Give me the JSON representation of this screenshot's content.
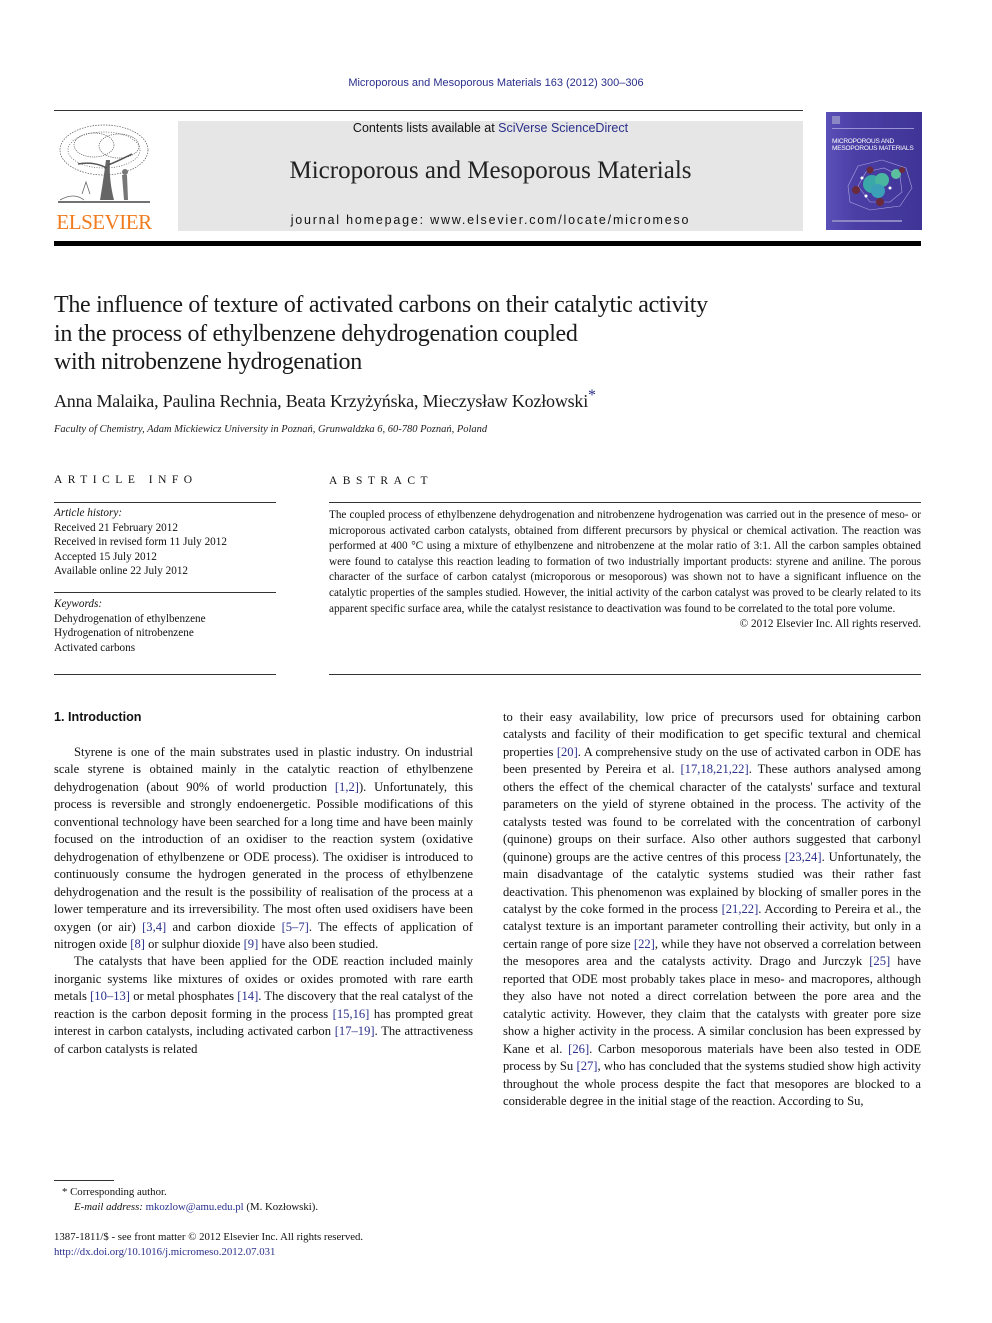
{
  "header": {
    "running_head": "Microporous and Mesoporous Materials 163 (2012) 300–306",
    "contents_prefix": "Contents lists available at ",
    "contents_link": "SciVerse ScienceDirect",
    "journal_title": "Microporous and Mesoporous Materials",
    "homepage": "journal homepage: www.elsevier.com/locate/micromeso",
    "publisher_logo_text": "ELSEVIER",
    "cover_title_line1": "MICROPOROUS AND",
    "cover_title_line2": "MESOPOROUS MATERIALS",
    "colors": {
      "link": "#2a2f8a",
      "elsevier_orange": "#f07c1f",
      "banner_bg": "#e6e6e6",
      "cover_bg": "#4b3fa6"
    }
  },
  "article": {
    "title_lines": [
      "The influence of texture of activated carbons on their catalytic activity",
      "in the process of ethylbenzene dehydrogenation coupled",
      "with nitrobenzene hydrogenation"
    ],
    "authors": "Anna Malaika, Paulina Rechnia, Beata Krzyżyńska, Mieczysław Kozłowski",
    "corresponding_mark": "*",
    "affiliation": "Faculty of Chemistry, Adam Mickiewicz University in Poznań, Grunwaldzka 6, 60-780 Poznań, Poland"
  },
  "article_info": {
    "heading": "ARTICLE INFO",
    "history_label": "Article history:",
    "history": [
      "Received 21 February 2012",
      "Received in revised form 11 July 2012",
      "Accepted 15 July 2012",
      "Available online 22 July 2012"
    ],
    "keywords_label": "Keywords:",
    "keywords": [
      "Dehydrogenation of ethylbenzene",
      "Hydrogenation of nitrobenzene",
      "Activated carbons"
    ]
  },
  "abstract": {
    "heading": "ABSTRACT",
    "text": "The coupled process of ethylbenzene dehydrogenation and nitrobenzene hydrogenation was carried out in the presence of meso- or microporous activated carbon catalysts, obtained from different precursors by physical or chemical activation. The reaction was performed at 400 °C using a mixture of ethylbenzene and nitrobenzene at the molar ratio of 3:1. All the carbon samples obtained were found to catalyse this reaction leading to formation of two industrially important products: styrene and aniline. The porous character of the surface of carbon catalyst (microporous or mesoporous) was shown not to have a significant influence on the catalytic properties of the samples studied. However, the initial activity of the carbon catalyst was proved to be clearly related to its apparent specific surface area, while the catalyst resistance to deactivation was found to be correlated to the total pore volume.",
    "copyright": "© 2012 Elsevier Inc. All rights reserved."
  },
  "intro": {
    "heading": "1. Introduction",
    "p1": [
      {
        "t": "Styrene is one of the main substrates used in plastic industry. On industrial scale styrene is obtained mainly in the catalytic reaction of ethylbenzene dehydrogenation (about 90% of world production "
      },
      {
        "t": "[1,2]",
        "ref": true
      },
      {
        "t": "). Unfortunately, this process is reversible and strongly endoenergetic. Possible modifications of this conventional technology have been searched for a long time and have been mainly focused on the introduction of an oxidiser to the reaction system (oxidative dehydrogenation of ethylbenzene or ODE process). The oxidiser is introduced to continuously consume the hydrogen generated in the process of ethylbenzene dehydrogenation and the result is the possibility of realisation of the process at a lower temperature and its irreversibility. The most often used oxidisers have been oxygen (or air) "
      },
      {
        "t": "[3,4]",
        "ref": true
      },
      {
        "t": " and carbon dioxide "
      },
      {
        "t": "[5–7]",
        "ref": true
      },
      {
        "t": ". The effects of application of nitrogen oxide "
      },
      {
        "t": "[8]",
        "ref": true
      },
      {
        "t": " or sulphur dioxide "
      },
      {
        "t": "[9]",
        "ref": true
      },
      {
        "t": " have also been studied."
      }
    ],
    "p2": [
      {
        "t": "The catalysts that have been applied for the ODE reaction included mainly inorganic systems like mixtures of oxides or oxides promoted with rare earth metals "
      },
      {
        "t": "[10–13]",
        "ref": true
      },
      {
        "t": " or metal phosphates "
      },
      {
        "t": "[14]",
        "ref": true
      },
      {
        "t": ". The discovery that the real catalyst of the reaction is the carbon deposit forming in the process "
      },
      {
        "t": "[15,16]",
        "ref": true
      },
      {
        "t": " has prompted great interest in carbon catalysts, including activated carbon "
      },
      {
        "t": "[17–19]",
        "ref": true
      },
      {
        "t": ". The attractiveness of carbon catalysts is related"
      }
    ],
    "p3": [
      {
        "t": "to their easy availability, low price of precursors used for obtaining carbon catalysts and facility of their modification to get specific textural and chemical properties "
      },
      {
        "t": "[20]",
        "ref": true
      },
      {
        "t": ". A comprehensive study on the use of activated carbon in ODE has been presented by Pereira et al. "
      },
      {
        "t": "[17,18,21,22]",
        "ref": true
      },
      {
        "t": ". These authors analysed among others the effect of the chemical character of the catalysts' surface and textural parameters on the yield of styrene obtained in the process. The activity of the catalysts tested was found to be correlated with the concentration of carbonyl (quinone) groups on their surface. Also other authors suggested that carbonyl (quinone) groups are the active centres of this process "
      },
      {
        "t": "[23,24]",
        "ref": true
      },
      {
        "t": ". Unfortunately, the main disadvantage of the catalytic systems studied was their rather fast deactivation. This phenomenon was explained by blocking of smaller pores in the catalyst by the coke formed in the process "
      },
      {
        "t": "[21,22]",
        "ref": true
      },
      {
        "t": ". According to Pereira et al., the catalyst texture is an important parameter controlling their activity, but only in a certain range of pore size "
      },
      {
        "t": "[22]",
        "ref": true
      },
      {
        "t": ", while they have not observed a correlation between the mesopores area and the catalysts activity. Drago and Jurczyk "
      },
      {
        "t": "[25]",
        "ref": true
      },
      {
        "t": " have reported that ODE most probably takes place in meso- and macropores, although they also have not noted a direct correlation between the pore area and the catalytic activity. However, they claim that the catalysts with greater pore size show a higher activity in the process. A similar conclusion has been expressed by Kane et al. "
      },
      {
        "t": "[26]",
        "ref": true
      },
      {
        "t": ". Carbon mesoporous materials have been also tested in ODE process by Su "
      },
      {
        "t": "[27]",
        "ref": true
      },
      {
        "t": ", who has concluded that the systems studied show high activity throughout the whole process despite the fact that mesopores are blocked to a considerable degree in the initial stage of the reaction. According to Su,"
      }
    ]
  },
  "footnotes": {
    "corresponding_mark": "*",
    "corresponding_text": "Corresponding author.",
    "email_label": "E-mail address:",
    "email": "mkozlow@amu.edu.pl",
    "email_suffix": " (M. Kozłowski).",
    "front_matter": "1387-1811/$ - see front matter © 2012 Elsevier Inc. All rights reserved.",
    "doi": "http://dx.doi.org/10.1016/j.micromeso.2012.07.031"
  }
}
